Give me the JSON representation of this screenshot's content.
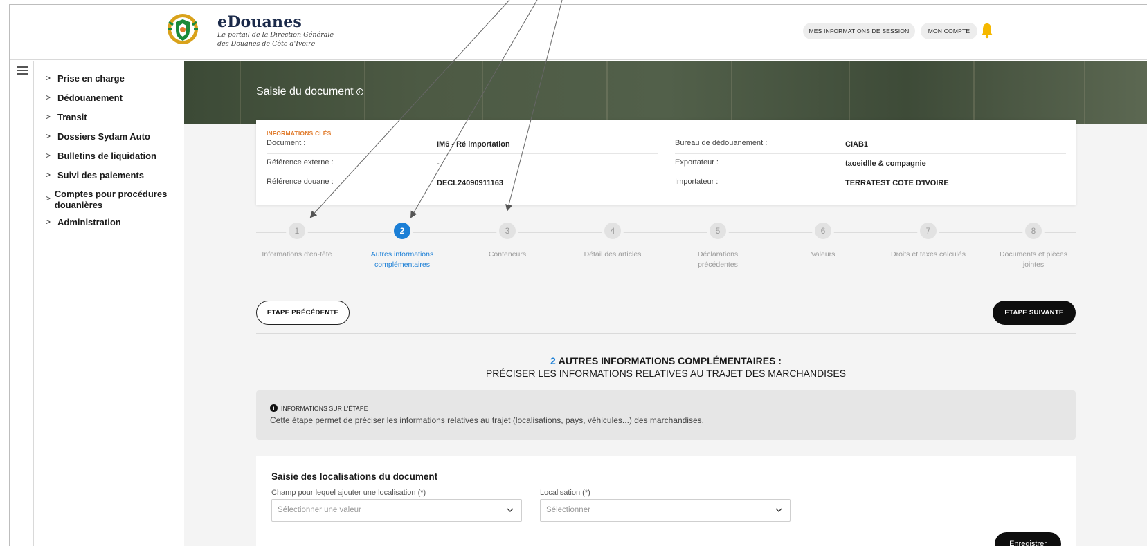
{
  "header": {
    "brand_title": "eDouanes",
    "brand_subtitle_line1": "Le portail de la Direction Générale",
    "brand_subtitle_line2": "des Douanes de Côte d'Ivoire",
    "session_button": "MES INFORMATIONS DE SESSION",
    "account_button": "MON COMPTE"
  },
  "sidenav": {
    "items": [
      {
        "label": "Prise en charge"
      },
      {
        "label": "Dédouanement"
      },
      {
        "label": "Transit"
      },
      {
        "label": "Dossiers Sydam Auto"
      },
      {
        "label": "Bulletins de liquidation"
      },
      {
        "label": "Suivi des paiements"
      },
      {
        "label": "Comptes pour procédures douanières"
      },
      {
        "label": "Administration"
      }
    ]
  },
  "banner": {
    "title": "Saisie du document"
  },
  "key_info": {
    "heading": "INFORMATIONS CLÉS",
    "left": [
      {
        "key": "Document :",
        "value": "IM6 - Ré importation"
      },
      {
        "key": "Référence externe :",
        "value": "-"
      },
      {
        "key": "Référence douane :",
        "value": "DECL24090911163"
      }
    ],
    "right": [
      {
        "key": "Bureau de dédouanement :",
        "value": "CIAB1"
      },
      {
        "key": "Exportateur :",
        "value": "taoeidlle & compagnie"
      },
      {
        "key": "Importateur :",
        "value": "TERRATEST COTE D'IVOIRE"
      }
    ]
  },
  "stepper": {
    "active_step": 2,
    "steps": [
      {
        "num": "1",
        "label": "Informations d'en-tête"
      },
      {
        "num": "2",
        "label": "Autres informations complémentaires"
      },
      {
        "num": "3",
        "label": "Conteneurs"
      },
      {
        "num": "4",
        "label": "Détail des articles"
      },
      {
        "num": "5",
        "label": "Déclarations précédentes"
      },
      {
        "num": "6",
        "label": "Valeurs"
      },
      {
        "num": "7",
        "label": "Droits et taxes calculés"
      },
      {
        "num": "8",
        "label": "Documents et pièces jointes"
      }
    ]
  },
  "nav_buttons": {
    "previous": "ETAPE PRÉCÉDENTE",
    "next": "ETAPE SUIVANTE"
  },
  "section": {
    "number": "2",
    "title": "AUTRES INFORMATIONS COMPLÉMENTAIRES :",
    "subtitle": "PRÉCISER LES INFORMATIONS RELATIVES AU TRAJET DES MARCHANDISES"
  },
  "step_info": {
    "heading": "INFORMATIONS SUR L'ÉTAPE",
    "text": "Cette étape permet de préciser les informations relatives au trajet (localisations, pays, véhicules...) des marchandises."
  },
  "form": {
    "title": "Saisie des localisations du document",
    "field1_label": "Champ pour lequel ajouter une localisation (*)",
    "field1_placeholder": "Sélectionner une valeur",
    "field2_label": "Localisation (*)",
    "field2_placeholder": "Sélectionner",
    "save_button": "Enregistrer"
  },
  "colors": {
    "accent_blue": "#1b7fd6",
    "key_info_heading": "#e07b2c",
    "bell": "#f5b800"
  }
}
